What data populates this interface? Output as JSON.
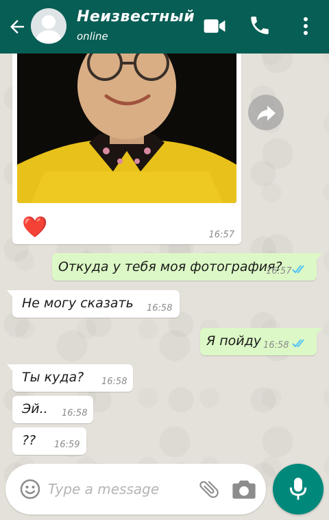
{
  "colors": {
    "header_bg": "#075e54",
    "incoming_bg": "#ffffff",
    "outgoing_bg": "#dcf8c6",
    "read_ticks": "#4fc3f7",
    "mic_bg": "#00897b"
  },
  "header": {
    "back_icon": "arrow-left-icon",
    "contact_name": "Неизвестный",
    "contact_status": "online",
    "icons": [
      "video-camera-icon",
      "phone-icon",
      "more-vertical-icon"
    ]
  },
  "image_message": {
    "emoji": "❤️",
    "time": "16:57",
    "forward_icon": "forward-icon"
  },
  "messages": [
    {
      "direction": "out",
      "text": "Откуда у тебя моя фотография?",
      "time": "16:57",
      "status": "read"
    },
    {
      "direction": "in",
      "text": "Не могу сказать",
      "time": "16:58"
    },
    {
      "direction": "out",
      "text": "Я пойду",
      "time": "16:58",
      "status": "read"
    },
    {
      "direction": "in",
      "text": "Ты куда?",
      "time": "16:58"
    },
    {
      "direction": "in",
      "text": "Эй..",
      "time": "16:58"
    },
    {
      "direction": "in",
      "text": "??",
      "time": "16:59"
    }
  ],
  "composer": {
    "placeholder": "Type a message",
    "icons": [
      "emoji-icon",
      "attach-icon",
      "camera-icon",
      "microphone-icon"
    ]
  }
}
